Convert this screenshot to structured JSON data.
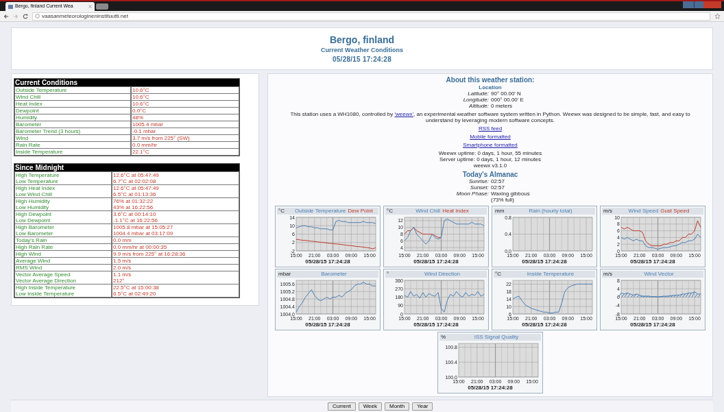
{
  "browser": {
    "tab_title": "Bergo, finland Current Wea",
    "url": "vaasanmeteorologineninstituutti.net"
  },
  "header": {
    "title": "Bergo, finland",
    "subtitle": "Current Weather Conditions",
    "timestamp": "05/28/15 17:24:28"
  },
  "current_conditions": {
    "title": "Current Conditions",
    "rows": [
      {
        "label": "Outside Temperature",
        "value": "10.6°C"
      },
      {
        "label": "Wind Chill",
        "value": "10.6°C"
      },
      {
        "label": "Heat Index",
        "value": "10.6°C"
      },
      {
        "label": "Dewpoint",
        "value": "0.0°C"
      },
      {
        "label": "Humidity",
        "value": "48%"
      },
      {
        "label": "Barometer",
        "value": "1005.4 mbar"
      },
      {
        "label": "Barometer Trend (3 hours)",
        "value": "-0.1 mbar"
      },
      {
        "label": "Wind",
        "value": "3.7 m/s from 225° (SW)"
      },
      {
        "label": "Rain Rate",
        "value": "0.0 mm/hr"
      },
      {
        "label": "Inside Temperature",
        "value": "22.1°C"
      }
    ]
  },
  "since_midnight": {
    "title": "Since Midnight",
    "rows": [
      {
        "labels": [
          "High Temperature",
          "Low Temperature"
        ],
        "values": [
          "12.6°C at 05:47:49",
          "6.7°C at 02:02:08"
        ]
      },
      {
        "labels": [
          "High Heat Index",
          "Low Wind Chill"
        ],
        "values": [
          "12.6°C at 05:47:49",
          "6.5°C at 01:13:36"
        ]
      },
      {
        "labels": [
          "High Humidity",
          "Low Humidity"
        ],
        "values": [
          "76% at 01:32:22",
          "43% at 16:22:56"
        ]
      },
      {
        "labels": [
          "High Dewpoint",
          "Low Dewpoint"
        ],
        "values": [
          "3.6°C at 00:14:10",
          "-1.1°C at 16:22:56"
        ]
      },
      {
        "labels": [
          "High Barometer",
          "Low Barometer"
        ],
        "values": [
          "1005.8 mbar at 15:05:27",
          "1004.4 mbar at 03:17:09"
        ]
      },
      {
        "labels": [
          "Today's Rain"
        ],
        "values": [
          "0.0 mm"
        ]
      },
      {
        "labels": [
          "High Rain Rate"
        ],
        "values": [
          "0.0 mm/hr at 00:00:35"
        ]
      },
      {
        "labels": [
          "High Wind"
        ],
        "values": [
          "9.9 m/s from 225° at 16:28:36"
        ]
      },
      {
        "labels": [
          "Average Wind"
        ],
        "values": [
          "1.5 m/s"
        ]
      },
      {
        "labels": [
          "RMS Wind"
        ],
        "values": [
          "2.0 m/s"
        ]
      },
      {
        "labels": [
          "Vector Average Speed",
          "Vector Average Direction"
        ],
        "values": [
          "1.1 m/s",
          "212°"
        ]
      },
      {
        "labels": [
          "High Inside Temperature",
          "Low Inside Temperature"
        ],
        "values": [
          "22.5°C at 15:00:38",
          "6.5°C at 02:49:20"
        ]
      }
    ]
  },
  "about": {
    "title": "About this weather station:",
    "location_heading": "Location",
    "location": [
      {
        "label": "Latitude:",
        "value": "90° 00.00' N"
      },
      {
        "label": "Longitude:",
        "value": "000° 00.00' E"
      },
      {
        "label": "Altitude:",
        "value": "0 meters"
      }
    ],
    "text_before": "This station uses a WH1080, controlled by ",
    "link": "'weewx'",
    "text_after": ", an experimental weather software system written in Python. Weewx was designed to be simple, fast, and easy to understand by leveraging modern software concepts.",
    "links": [
      "RSS feed",
      "Mobile formatted",
      "Smartphone formatted"
    ],
    "uptime": [
      "Weewx uptime: 0 days, 1 hour, 55 minutes",
      "Server uptime: 0 days, 1 hour, 12 minutes",
      "weewx v3.1.0"
    ]
  },
  "almanac": {
    "title": "Today's Almanac",
    "items": [
      {
        "label": "Sunrise:",
        "value": [
          "02:57"
        ]
      },
      {
        "label": "Sunset:",
        "value": [
          "02:57"
        ]
      },
      {
        "label": "Moon Phase:",
        "value": [
          "Waxing gibbous",
          "(73% full)"
        ]
      }
    ]
  },
  "charts": [
    {
      "kind": "line",
      "timestamp": "05/28/15 17:24:28",
      "chart_data": {
        "type": "line",
        "ylabel": "°C",
        "ylim": [
          -2,
          14
        ],
        "grid": true,
        "categories": [
          "15:00",
          null,
          null,
          null,
          null,
          null,
          "21:00",
          null,
          null,
          null,
          null,
          null,
          "03:00",
          null,
          null,
          null,
          null,
          null,
          "09:00",
          null,
          null,
          null,
          null,
          null,
          "15:00",
          null,
          null
        ],
        "yticks": [
          {
            "value": 14,
            "label": "14"
          },
          {
            "value": 10,
            "label": "10"
          },
          {
            "value": 6,
            "label": "6"
          },
          {
            "value": 2,
            "label": "2"
          },
          {
            "value": -2,
            "label": "-2"
          }
        ],
        "series": [
          {
            "name": "Outside Temperature",
            "color": "#4a7fb5",
            "values": [
              9,
              9.5,
              10,
              10,
              9.5,
              9.5,
              9,
              9,
              8.5,
              8.5,
              8.5,
              8,
              8,
              12,
              12.5,
              12,
              12,
              11.5,
              11.5,
              11.5,
              11.5,
              11.5,
              12,
              11.5,
              11.5,
              11.5,
              11
            ]
          },
          {
            "name": "Dew Point",
            "color": "#c0392b",
            "values": [
              3.5,
              3.3,
              3.1,
              3,
              2.8,
              2.6,
              2.5,
              2.3,
              2.1,
              2,
              1.8,
              1.6,
              1.5,
              1.3,
              1.2,
              1,
              0.8,
              0.6,
              0.5,
              0.3,
              0.1,
              0,
              -0.2,
              -0.4,
              -0.6,
              -1,
              -0.5
            ]
          }
        ]
      }
    },
    {
      "kind": "line",
      "timestamp": "05/28/15 17:24:28",
      "chart_data": {
        "type": "line",
        "ylabel": "°C",
        "ylim": [
          3,
          13
        ],
        "grid": true,
        "categories": [
          "15:00",
          null,
          null,
          null,
          null,
          null,
          "21:00",
          null,
          null,
          null,
          null,
          null,
          "03:00",
          null,
          null,
          null,
          null,
          null,
          "09:00",
          null,
          null,
          null,
          null,
          null,
          "15:00",
          null,
          null
        ],
        "yticks": [
          {
            "value": 12,
            "label": "12"
          },
          {
            "value": 10,
            "label": "10"
          },
          {
            "value": 8,
            "label": "8"
          },
          {
            "value": 6,
            "label": "6"
          },
          {
            "value": 4,
            "label": "4"
          }
        ],
        "series": [
          {
            "name": "Wind Chill",
            "color": "#4a7fb5",
            "values": [
              6,
              7,
              9,
              10,
              8,
              7,
              6,
              5,
              6,
              8,
              7,
              6.5,
              7,
              12,
              12.5,
              12,
              11.5,
              11,
              11,
              11,
              11,
              11,
              11.5,
              11,
              11,
              11,
              10.5
            ]
          },
          {
            "name": "Heat Index",
            "color": "#c0392b",
            "values": [
              8,
              9,
              9,
              10,
              9,
              8.5,
              8,
              8,
              8,
              8,
              7.5,
              7,
              7,
              null,
              null,
              null,
              null,
              null,
              null,
              null,
              null,
              null,
              null,
              null,
              null,
              null,
              null
            ]
          }
        ]
      }
    },
    {
      "timestamp": "05/28/15 17:24:28",
      "chart_data": {
        "type": "line",
        "title": "Rain (hourly total)",
        "ylabel": "mm",
        "ylim": [
          0,
          0.8
        ],
        "grid": true,
        "categories": [
          "15:00",
          null,
          null,
          null,
          null,
          null,
          "21:00",
          null,
          null,
          null,
          null,
          null,
          "03:00",
          null,
          null,
          null,
          null,
          null,
          "09:00",
          null,
          null,
          null,
          null,
          null,
          "15:00",
          null,
          null
        ],
        "yticks": [
          {
            "value": 0.8,
            "label": "0.8"
          },
          {
            "value": 0.4,
            "label": "0.4"
          },
          {
            "value": 0,
            "label": "0.0"
          }
        ]
      }
    },
    {
      "kind": "line",
      "timestamp": "05/28/15 17:24:28",
      "chart_data": {
        "type": "line",
        "ylabel": "m/s",
        "ylim": [
          0,
          10
        ],
        "grid": true,
        "categories": [
          "15:00",
          null,
          null,
          null,
          null,
          null,
          "21:00",
          null,
          null,
          null,
          null,
          null,
          "03:00",
          null,
          null,
          null,
          null,
          null,
          "09:00",
          null,
          null,
          null,
          null,
          null,
          "15:00",
          null,
          null
        ],
        "yticks": [
          {
            "value": 10,
            "label": "10"
          },
          {
            "value": 8,
            "label": "8"
          },
          {
            "value": 6,
            "label": "6"
          },
          {
            "value": 4,
            "label": "4"
          },
          {
            "value": 2,
            "label": "2"
          },
          {
            "value": 0,
            "label": "0"
          }
        ],
        "series": [
          {
            "name": "Wind Speed",
            "color": "#4a7fb5",
            "values": [
              4,
              3.5,
              4,
              3.5,
              3,
              3.5,
              3,
              3,
              1.5,
              1,
              1,
              0.8,
              0.5,
              0.8,
              1,
              1,
              1.2,
              1.5,
              1.5,
              2,
              2.5,
              2.5,
              3,
              3,
              3.5,
              5,
              4
            ]
          },
          {
            "name": "Gust Speed",
            "color": "#c0392b",
            "values": [
              7,
              6.5,
              7,
              6.5,
              6,
              6,
              6,
              5.5,
              3,
              2,
              1.5,
              1.5,
              1.5,
              1.5,
              2,
              2,
              2.5,
              2.5,
              3,
              3,
              4,
              4,
              5,
              5,
              6,
              9,
              7
            ]
          }
        ]
      }
    },
    {
      "kind": "line",
      "timestamp": "05/28/15 17:24:28",
      "chart_data": {
        "type": "line",
        "ylabel": "mbar",
        "ylim": [
          1004.0,
          1005.8
        ],
        "grid": true,
        "categories": [
          "15:00",
          null,
          null,
          null,
          null,
          null,
          "21:00",
          null,
          null,
          null,
          null,
          null,
          "03:00",
          null,
          null,
          null,
          null,
          null,
          "09:00",
          null,
          null,
          null,
          null,
          null,
          "15:00",
          null,
          null
        ],
        "yticks": [
          {
            "value": 1005.6,
            "label": "1005.6"
          },
          {
            "value": 1005.2,
            "label": "1005.2"
          },
          {
            "value": 1004.8,
            "label": "1004.8"
          },
          {
            "value": 1004.4,
            "label": "1004.4"
          },
          {
            "value": 1004.0,
            "label": "1004.0"
          }
        ],
        "series": [
          {
            "name": "Barometer",
            "color": "#4a7fb5",
            "values": [
              1004.1,
              1004.4,
              1004.6,
              1004.9,
              1005.1,
              1005.3,
              1005.0,
              1004.8,
              1004.7,
              1004.8,
              1004.9,
              1004.8,
              1004.9,
              1004.9,
              1005.0,
              1004.9,
              1005.1,
              1005.2,
              1005.3,
              1005.5,
              1005.6,
              1005.6,
              1005.7,
              1005.6,
              1005.6,
              1005.5,
              1005.5
            ]
          }
        ]
      }
    },
    {
      "kind": "line",
      "timestamp": "05/28/15 17:24:28",
      "chart_data": {
        "type": "line",
        "ylabel": "°",
        "ylim": [
          0,
          360
        ],
        "grid": true,
        "categories": [
          "15:00",
          null,
          null,
          null,
          null,
          null,
          "21:00",
          null,
          null,
          null,
          null,
          null,
          "03:00",
          null,
          null,
          null,
          null,
          null,
          "09:00",
          null,
          null,
          null,
          null,
          null,
          "15:00",
          null,
          null
        ],
        "yticks": [
          {
            "value": 360,
            "label": "360"
          },
          {
            "value": 270,
            "label": "270"
          },
          {
            "value": 180,
            "label": "180"
          },
          {
            "value": 90,
            "label": "90"
          },
          {
            "value": 0,
            "label": "0"
          }
        ],
        "series": [
          {
            "name": "Wind Direction",
            "color": "#4a7fb5",
            "values": [
              200,
              180,
              240,
              190,
              210,
              170,
              230,
              180,
              220,
              200,
              190,
              230,
              60,
              20,
              150,
              210,
              190,
              240,
              200,
              180,
              230,
              190,
              210,
              200,
              240,
              190,
              210
            ]
          }
        ]
      }
    },
    {
      "kind": "line",
      "timestamp": "05/28/15 17:24:28",
      "chart_data": {
        "type": "line",
        "ylabel": "°C",
        "ylim": [
          6,
          24
        ],
        "grid": true,
        "categories": [
          "15:00",
          null,
          null,
          null,
          null,
          null,
          "21:00",
          null,
          null,
          null,
          null,
          null,
          "03:00",
          null,
          null,
          null,
          null,
          null,
          "09:00",
          null,
          null,
          null,
          null,
          null,
          "15:00",
          null,
          null
        ],
        "yticks": [
          {
            "value": 22,
            "label": "22"
          },
          {
            "value": 18,
            "label": "18"
          },
          {
            "value": 14,
            "label": "14"
          },
          {
            "value": 10,
            "label": "10"
          },
          {
            "value": 6,
            "label": "6"
          }
        ],
        "series": [
          {
            "name": "Inside Temperature",
            "color": "#4a7fb5",
            "values": [
              14,
              15,
              15.5,
              13,
              11,
              10,
              9,
              8.5,
              8,
              7.5,
              7,
              7,
              6.5,
              6.5,
              7,
              7,
              12,
              18,
              20,
              21,
              21.5,
              22,
              22,
              22,
              22,
              22,
              22
            ]
          }
        ]
      }
    },
    {
      "kind": "vector",
      "timestamp": "05/28/15 17:24:28",
      "chart_data": {
        "type": "line",
        "ylabel": "m/s",
        "ylim": [
          -8,
          8
        ],
        "grid": true,
        "categories": [
          "15:00",
          null,
          null,
          null,
          null,
          null,
          "21:00",
          null,
          null,
          null,
          null,
          null,
          "03:00",
          null,
          null,
          null,
          null,
          null,
          "09:00",
          null,
          null,
          null,
          null,
          null,
          "15:00",
          null,
          null
        ],
        "yticks": [
          {
            "value": 8,
            "label": "8"
          },
          {
            "value": 4,
            "label": "4"
          },
          {
            "value": 0,
            "label": "0"
          },
          {
            "value": -4,
            "label": "-4"
          },
          {
            "value": -8,
            "label": "-8"
          }
        ],
        "series": [
          {
            "name": "Wind Vector",
            "color": "#4a7fb5",
            "values": [
              2,
              1.5,
              2,
              1.5,
              1,
              1.5,
              1,
              0.5,
              0.5,
              0.5,
              0.3,
              0.3,
              0.2,
              0.3,
              0.5,
              0.5,
              0.7,
              0.8,
              1,
              1,
              1.5,
              1.5,
              2,
              2,
              2.5,
              1.5,
              1.5
            ]
          }
        ]
      }
    },
    {
      "timestamp": "05/28/15 17:24:28",
      "chart_data": {
        "type": "line",
        "title": "ISS Signal Quality",
        "ylabel": "%",
        "ylim": [
          100.0,
          100.9
        ],
        "grid": true,
        "categories": [
          "15:00",
          null,
          null,
          null,
          null,
          null,
          "21:00",
          null,
          null,
          null,
          null,
          null,
          "03:00",
          null,
          null,
          null,
          null,
          null,
          "09:00",
          null,
          null,
          null,
          null,
          null,
          "15:00",
          null,
          null
        ],
        "yticks": [
          {
            "value": 100.8,
            "label": "100.8"
          },
          {
            "value": 100.4,
            "label": "100.4"
          },
          {
            "value": 100.0,
            "label": "100.0"
          }
        ]
      }
    }
  ],
  "nav_buttons": [
    "Current",
    "Week",
    "Month",
    "Year"
  ]
}
